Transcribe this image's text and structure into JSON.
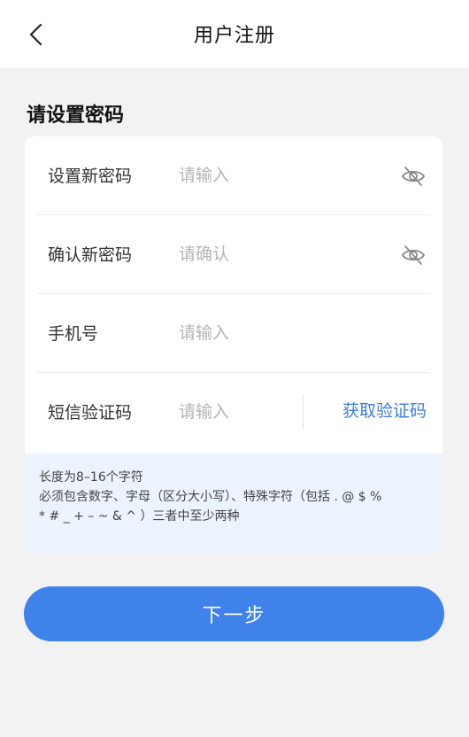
{
  "header": {
    "back_icon": "chevron-left-icon",
    "title": "用户注册"
  },
  "section_title": "请设置密码",
  "form": {
    "new_password": {
      "label": "设置新密码",
      "placeholder": "请输入",
      "value": "",
      "toggle_icon": "eye-off-icon"
    },
    "confirm_password": {
      "label": "确认新密码",
      "placeholder": "请确认",
      "value": "",
      "toggle_icon": "eye-off-icon"
    },
    "phone": {
      "label": "手机号",
      "placeholder": "请输入",
      "value": ""
    },
    "sms_code": {
      "label": "短信验证码",
      "placeholder": "请输入",
      "value": "",
      "get_code_label": "获取验证码"
    }
  },
  "hint": {
    "line1": "长度为8–16个字符",
    "line2": "必须包含数字、字母（区分大小写）、特殊字符（包括 . @ $ %",
    "line3": "* # _ + – ~ & ^ ）三者中至少两种"
  },
  "next_button": "下一步",
  "colors": {
    "accent": "#3f82ea",
    "link": "#3c7de0",
    "background": "#f2f2f2",
    "hint_background": "#ecf3fc"
  }
}
